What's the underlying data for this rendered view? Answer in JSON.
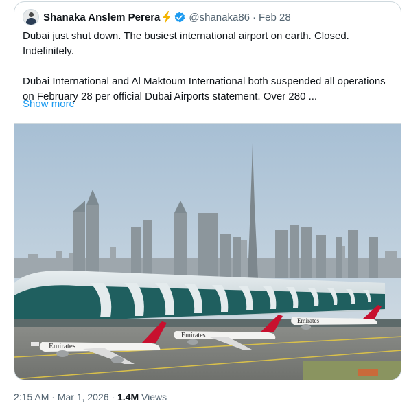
{
  "post": {
    "author": {
      "name": "Shanaka Anslem Perera",
      "handle": "@shanaka86",
      "badge_emoji": "lightning-bolt-icon",
      "verified": true
    },
    "separator": "·",
    "date": "Feb 28",
    "text_paragraphs": [
      "Dubai just shut down. The busiest international airport on earth. Closed. Indefinitely.",
      "Dubai International and Al Maktoum International both suspended all operations on February 28 per official Dubai Airports statement. Over 280 ..."
    ],
    "show_more": "Show more",
    "image": {
      "subject": "airport-terminal-photo",
      "livery_text": "Emirates"
    }
  },
  "footer": {
    "time": "2:15 AM",
    "separator1": " · ",
    "date": "Mar 1, 2026",
    "separator2": " · ",
    "views_count": "1.4M",
    "views_label": " Views"
  },
  "colors": {
    "link": "#1d9bf0",
    "secondary_text": "#536471",
    "verified": "#1d9bf0",
    "bolt": "#f4b400"
  }
}
